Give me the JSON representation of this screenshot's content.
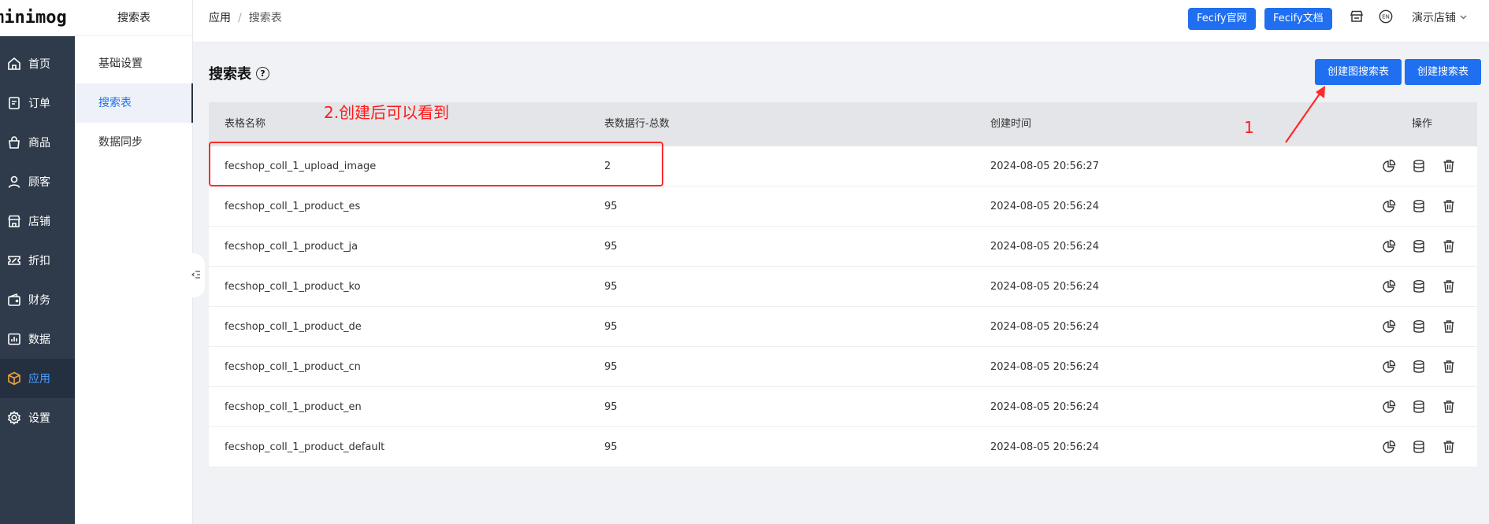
{
  "nav": {
    "logo": "minimog",
    "items": [
      {
        "label": "首页",
        "icon": "home-icon"
      },
      {
        "label": "订单",
        "icon": "order-icon"
      },
      {
        "label": "商品",
        "icon": "bag-icon"
      },
      {
        "label": "顾客",
        "icon": "user-icon"
      },
      {
        "label": "店铺",
        "icon": "store-icon"
      },
      {
        "label": "折扣",
        "icon": "coupon-icon"
      },
      {
        "label": "财务",
        "icon": "wallet-icon"
      },
      {
        "label": "数据",
        "icon": "chart-icon"
      },
      {
        "label": "应用",
        "icon": "cube-icon",
        "active": true
      },
      {
        "label": "设置",
        "icon": "gear-icon"
      }
    ]
  },
  "submenu": {
    "title": "搜索表",
    "items": [
      {
        "label": "基础设置"
      },
      {
        "label": "搜索表",
        "active": true
      },
      {
        "label": "数据同步"
      }
    ]
  },
  "header": {
    "breadcrumb": {
      "root": "应用",
      "separator": "/",
      "current": "搜索表"
    },
    "buttons": {
      "official_site": "Fecify官网",
      "docs": "Fecify文档"
    },
    "store_name": "演示店铺"
  },
  "page": {
    "title": "搜索表",
    "actions": {
      "create_image_search": "创建图搜索表",
      "create_search": "创建搜索表"
    }
  },
  "table": {
    "headers": {
      "name": "表格名称",
      "count": "表数据行-总数",
      "created": "创建时间",
      "actions": "操作"
    },
    "rows": [
      {
        "name": "fecshop_coll_1_upload_image",
        "count": "2",
        "created": "2024-08-05 20:56:27"
      },
      {
        "name": "fecshop_coll_1_product_es",
        "count": "95",
        "created": "2024-08-05 20:56:24"
      },
      {
        "name": "fecshop_coll_1_product_ja",
        "count": "95",
        "created": "2024-08-05 20:56:24"
      },
      {
        "name": "fecshop_coll_1_product_ko",
        "count": "95",
        "created": "2024-08-05 20:56:24"
      },
      {
        "name": "fecshop_coll_1_product_de",
        "count": "95",
        "created": "2024-08-05 20:56:24"
      },
      {
        "name": "fecshop_coll_1_product_cn",
        "count": "95",
        "created": "2024-08-05 20:56:24"
      },
      {
        "name": "fecshop_coll_1_product_en",
        "count": "95",
        "created": "2024-08-05 20:56:24"
      },
      {
        "name": "fecshop_coll_1_product_default",
        "count": "95",
        "created": "2024-08-05 20:56:24"
      }
    ]
  },
  "annotations": {
    "step2": "2.创建后可以看到",
    "step1": "1"
  },
  "colors": {
    "primary": "#1f6ff0",
    "nav_bg": "#2f3b4b",
    "annotation": "#ff2a2a"
  }
}
